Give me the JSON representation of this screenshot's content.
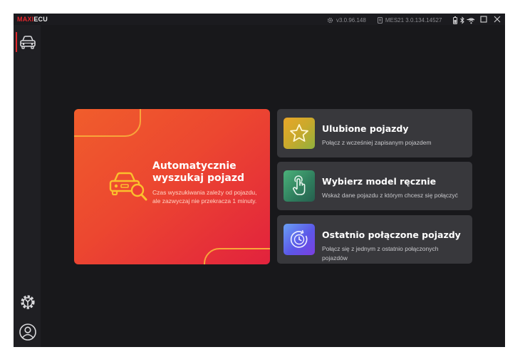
{
  "titlebar": {
    "logo_red": "MAXI",
    "logo_white": "ECU",
    "version": "v3.0.96.148",
    "device": "MES21 3.0.134.14527"
  },
  "sidebar": {
    "items": [
      {
        "name": "vehicle",
        "icon": "car-icon",
        "active": true
      },
      {
        "name": "settings",
        "icon": "gear-wrench-icon",
        "active": false
      },
      {
        "name": "account",
        "icon": "user-icon",
        "active": false
      }
    ]
  },
  "auto_search": {
    "title": "Automatycznie wyszukaj pojazd",
    "description": "Czas wyszukiwania zależy od pojazdu, ale zazwyczaj nie przekracza 1 minuty.",
    "icon": "car-search-icon"
  },
  "options": [
    {
      "title": "Ulubione pojazdy",
      "description": "Połącz z wcześniej zapisanym pojazdem",
      "icon": "star-icon"
    },
    {
      "title": "Wybierz model ręcznie",
      "description": "Wskaż dane pojazdu z którym chcesz się połączyć",
      "icon": "tap-hand-icon"
    },
    {
      "title": "Ostatnio połączone pojazdy",
      "description": "Połącz się z jednym z ostatnio połączonych pojazdów",
      "icon": "history-clock-icon"
    }
  ],
  "colors": {
    "accent": "#e5252b",
    "card_gradient_start": "#f05d2c",
    "card_gradient_end": "#e2223d",
    "background": "#18181b",
    "option_card": "#38383c"
  }
}
